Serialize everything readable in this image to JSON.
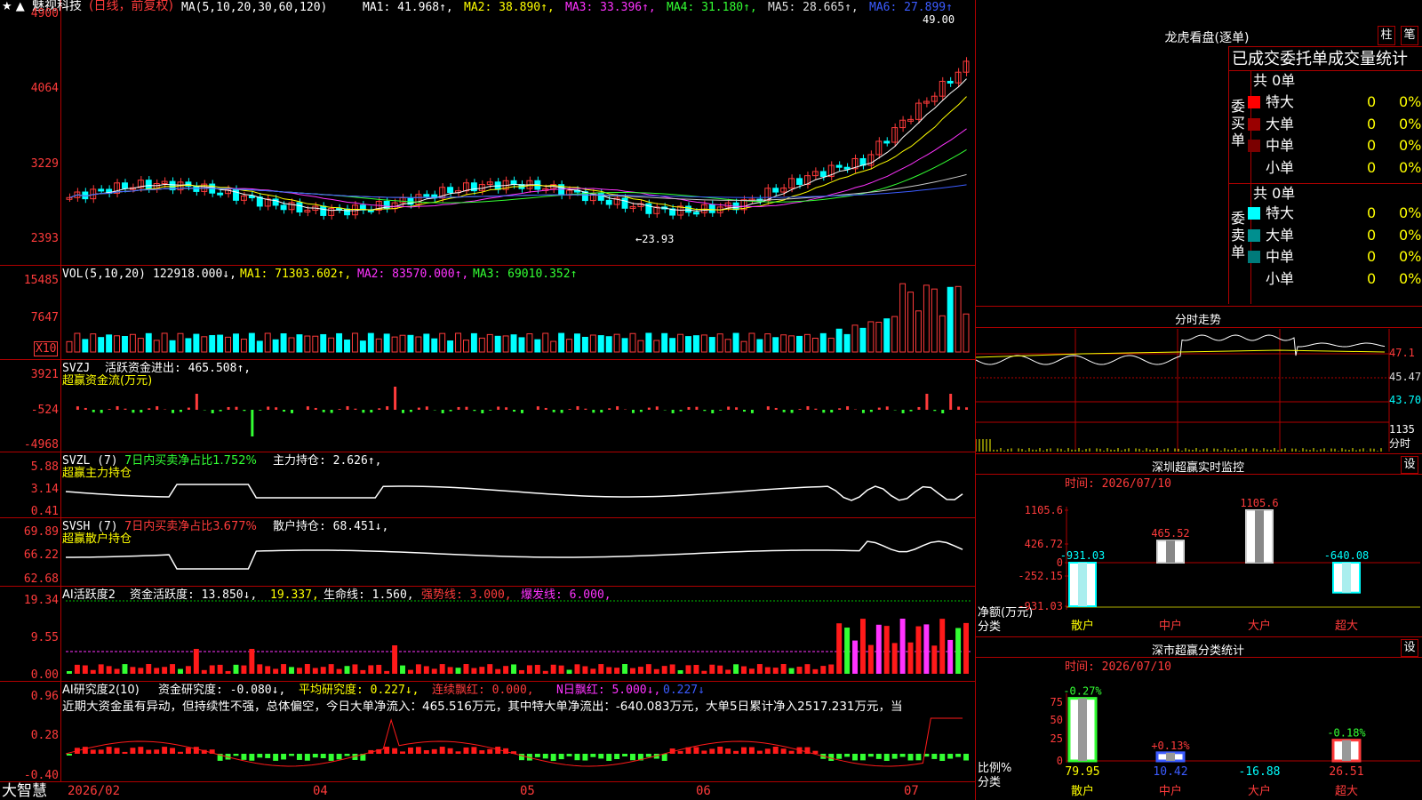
{
  "header": {
    "stock_name": "魅视科技",
    "period": "(日线，前复权)",
    "ma_label": "MA(5,10,20,30,60,120)",
    "ma1": "MA1: 41.968↑,",
    "ma2": "MA2: 38.890↑,",
    "ma3": "MA3: 33.396↑,",
    "ma4": "MA4: 31.180↑,",
    "ma5": "MA5: 28.665↑,",
    "ma6": "MA6: 27.899↑",
    "high_mark": "49.00",
    "low_mark": "←23.93"
  },
  "price_axis": [
    "4900",
    "4064",
    "3229",
    "2393"
  ],
  "vol": {
    "label": "VOL(5,10,20)",
    "val": "122918.000↓,",
    "ma1": "MA1: 71303.602↑,",
    "ma2": "MA2: 83570.000↑,",
    "ma3": "MA3: 69010.352↑",
    "axis": [
      "15485",
      "7647"
    ],
    "unit": "X10"
  },
  "svzj": {
    "label": "SVZJ",
    "text": "活跃资金进出: 465.508↑,",
    "sub": "超赢资金流(万元)",
    "axis": [
      "3921",
      "-524",
      "-4968"
    ]
  },
  "svzl": {
    "label": "SVZL  (7)",
    "text1": "7日内买卖净占比1.752%",
    "text2": "主力持仓: 2.626↑,",
    "sub": "超赢主力持仓",
    "axis": [
      "5.88",
      "3.14",
      "0.41"
    ]
  },
  "svsh": {
    "label": "SVSH  (7)",
    "text1": "7日内买卖净占比3.677%",
    "text2": "散户持仓: 68.451↓,",
    "sub": "超赢散户持仓",
    "axis": [
      "69.89",
      "66.22",
      "62.68"
    ]
  },
  "ai1": {
    "label": "AI活跃度2",
    "t1": "资金活跃度: 13.850↓,",
    "t2": "19.337,",
    "t3": "生命线: 1.560,",
    "t4": "强势线: 3.000,",
    "t5": "爆发线: 6.000,",
    "axis": [
      "19.34",
      "9.55",
      "0.00"
    ]
  },
  "ai2": {
    "label": "AI研究度2(10)",
    "t1": "资金研究度: -0.080↓,",
    "t2": "平均研究度: 0.227↓,",
    "t3": "连续飘红: 0.000,",
    "t4": "N日飘红: 5.000↓,",
    "t5": "0.227↓",
    "comment": "近期大资金虽有异动，但持续性不强，总体偏空，今日大单净流入：465.516万元，其中特大单净流出：-640.083万元，大单5日累计净入2517.231万元，当",
    "axis": [
      "0.96",
      "0.28",
      "-0.40"
    ]
  },
  "xaxis": [
    "2026/02",
    "04",
    "05",
    "06",
    "07"
  ],
  "brand": "大智慧",
  "right": {
    "title": "龙虎看盘(逐单)",
    "btn1": "柱",
    "btn2": "笔",
    "order_title": "已成交委托单成交量统计",
    "buy_side": "委买单",
    "sell_side": "委卖单",
    "buy_total": "共 0单",
    "sell_total": "共 0单",
    "buy_rows": [
      {
        "label": "特大",
        "n": "0",
        "p": "0%",
        "color": "#ff0000"
      },
      {
        "label": "大单",
        "n": "0",
        "p": "0%",
        "color": "#9a0000"
      },
      {
        "label": "中单",
        "n": "0",
        "p": "0%",
        "color": "#7a0000"
      },
      {
        "label": "小单",
        "n": "0",
        "p": "0%",
        "color": ""
      }
    ],
    "sell_rows": [
      {
        "label": "特大",
        "n": "0",
        "p": "0%",
        "color": "#00ffff"
      },
      {
        "label": "大单",
        "n": "0",
        "p": "0%",
        "color": "#008f8f"
      },
      {
        "label": "中单",
        "n": "0",
        "p": "0%",
        "color": "#007a7a"
      },
      {
        "label": "小单",
        "n": "0",
        "p": "0%",
        "color": ""
      }
    ],
    "intraday_title": "分时走势",
    "intraday_axis": [
      "47.1",
      "45.47",
      "43.70",
      "1135"
    ],
    "intraday_unit": "分时",
    "sz_title": "深圳超赢实时监控",
    "sz_btn": "设",
    "sz_time": "时间: 2026/07/10",
    "sz_axis": [
      "1105.6",
      "426.72",
      "0",
      "-252.15",
      "-931.03"
    ],
    "sz_ylabel": "净额(万元)",
    "sz_xlabel": "分类",
    "sz_cats": [
      "散户",
      "中户",
      "大户",
      "超大"
    ],
    "sz_values": [
      -931.03,
      465.52,
      1105.6,
      -640.08
    ],
    "sz_value_labels": [
      "-931.03",
      "465.52",
      "1105.6",
      "-640.08"
    ],
    "cls_title": "深市超赢分类统计",
    "cls_btn": "设",
    "cls_time": "时间: 2026/07/10",
    "cls_axis": [
      "75",
      "50",
      "25",
      "0"
    ],
    "cls_ylabel": "比例%",
    "cls_xlabel": "分类",
    "cls_cats": [
      "散户",
      "中户",
      "大户",
      "超大"
    ],
    "cls_values": [
      79.95,
      10.42,
      -16.88,
      26.51
    ],
    "cls_value_labels": [
      "79.95",
      "10.42",
      "-16.88",
      "26.51"
    ],
    "cls_change_labels": [
      "-0.27%",
      "+0.13%",
      "",
      "-0.18%"
    ]
  },
  "colors": {
    "up": "#ff3b3b",
    "down": "#00ffff",
    "grid": "#b00000",
    "ma1": "#ffffff",
    "ma2": "#ffff00",
    "ma3": "#ff33ff",
    "ma4": "#33ff33",
    "ma5": "#c8c8c8",
    "ma6": "#3b5bff"
  }
}
